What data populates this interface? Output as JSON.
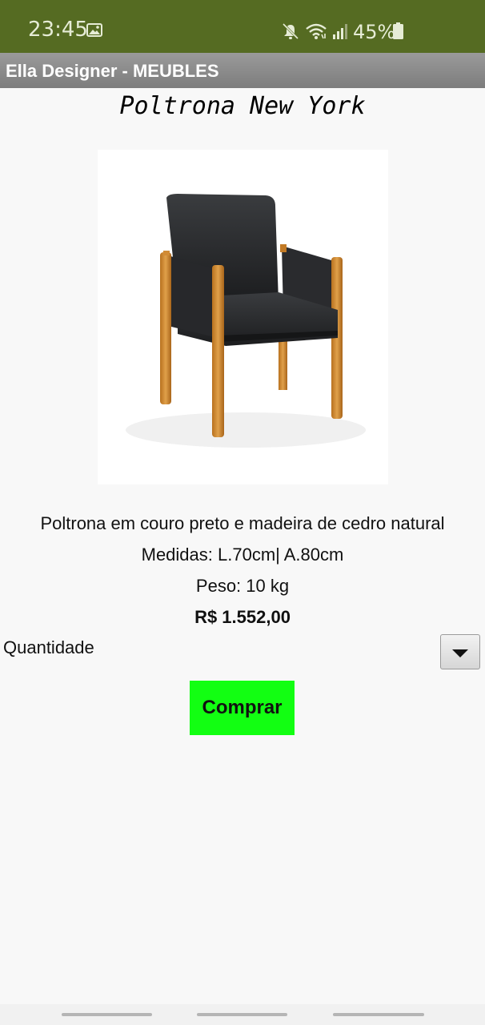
{
  "status_bar": {
    "time": "23:45",
    "battery": "45%",
    "icons": [
      "image-icon",
      "mute-icon",
      "wifi-icon",
      "signal-icon",
      "battery-icon"
    ]
  },
  "app": {
    "title": "Ella Designer - MEUBLES"
  },
  "product": {
    "title": "Poltrona New York",
    "image_icon": "armchair-image",
    "description": "Poltrona em couro preto e madeira de cedro natural",
    "measures": "Medidas: L.70cm| A.80cm",
    "weight": "Peso: 10 kg",
    "price": "R$ 1.552,00"
  },
  "quantity": {
    "label": "Quantidade",
    "dropdown_icon": "chevron-down-icon"
  },
  "buy_button": {
    "label": "Comprar"
  },
  "colors": {
    "status_bar": "#556b22",
    "title_bar": "#8a8a8a",
    "buy_button": "#12ff12",
    "background": "#f8f8f8"
  }
}
